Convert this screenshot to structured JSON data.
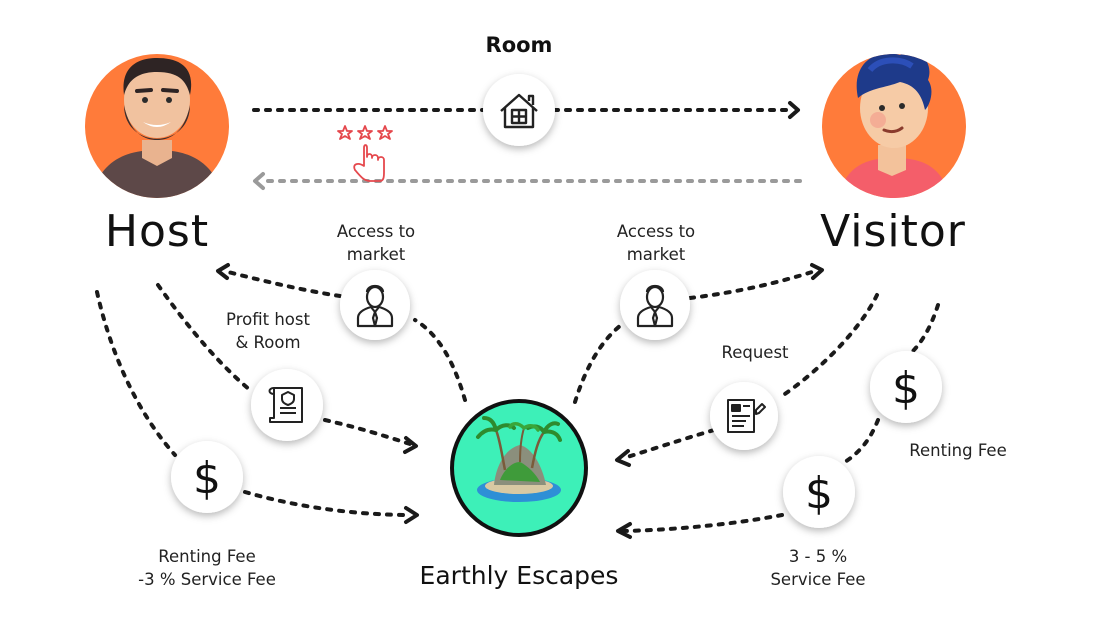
{
  "diagram": {
    "top_label": "Room",
    "host": {
      "name": "Host",
      "avatar_icon": "bearded-man-avatar-icon",
      "circle_color": "#FF7B3A"
    },
    "visitor": {
      "name": "Visitor",
      "avatar_icon": "young-man-avatar-icon",
      "circle_color": "#FF7B3A"
    },
    "center": {
      "name": "Earthly Escapes",
      "icon": "tropical-island-icon",
      "circle_color": "#3DF0B8"
    },
    "labels": {
      "access_left": "Access to\nmarket",
      "access_right": "Access to\nmarket",
      "profit": "Profit host\n& Room",
      "request": "Request",
      "renting_fee_right": "Renting Fee",
      "renting_fee_left": "Renting Fee\n-3 % Service Fee",
      "service_fee": "3 - 5 %\nService Fee"
    },
    "icons": {
      "room": "house-icon",
      "rating": "star-rating-hand-icon",
      "access_left": "businessman-icon",
      "access_right": "businessman-icon",
      "profit": "contract-scroll-icon",
      "request": "request-form-icon",
      "fee_left": "dollar-icon",
      "fee_right": "dollar-icon",
      "service_fee": "dollar-icon"
    },
    "colors": {
      "arrow": "#1a1a1a",
      "return_arrow": "#9a9a9a",
      "rating": "#E5484D"
    }
  }
}
